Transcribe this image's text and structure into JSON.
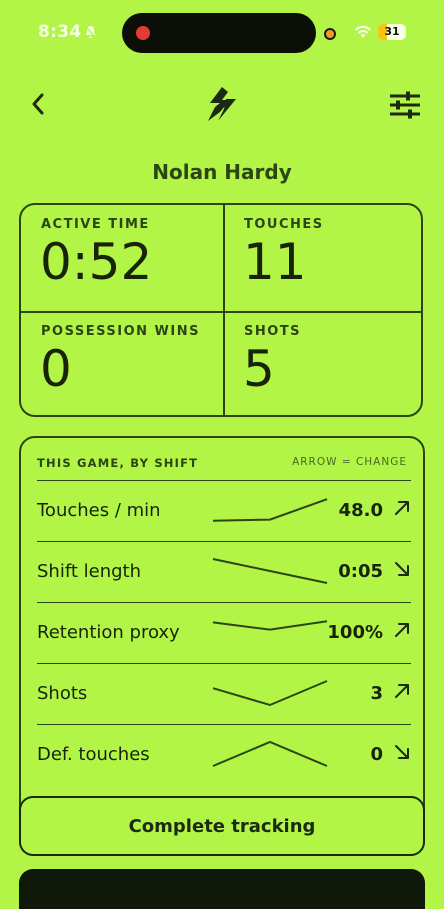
{
  "status_bar": {
    "time": "8:34",
    "battery": "31",
    "battery_level": 0.31
  },
  "player": {
    "name": "Nolan Hardy"
  },
  "stats": [
    {
      "label": "ACTIVE TIME",
      "value": "0:52"
    },
    {
      "label": "TOUCHES",
      "value": "11"
    },
    {
      "label": "POSSESSION WINS",
      "value": "0"
    },
    {
      "label": "SHOTS",
      "value": "5"
    }
  ],
  "shifts": {
    "title": "THIS GAME, BY SHIFT",
    "hint": "ARROW = CHANGE",
    "rows": [
      {
        "label": "Touches / min",
        "value": "48.0",
        "trend": "up",
        "spark": [
          0.05,
          0.1,
          0.95
        ]
      },
      {
        "label": "Shift length",
        "value": "0:05",
        "trend": "down",
        "spark": [
          1.0,
          0.5,
          0.0
        ]
      },
      {
        "label": "Retention proxy",
        "value": "100%",
        "trend": "up",
        "spark": [
          0.9,
          0.6,
          0.95
        ]
      },
      {
        "label": "Shots",
        "value": "3",
        "trend": "up",
        "spark": [
          0.7,
          0.0,
          1.0
        ]
      },
      {
        "label": "Def. touches",
        "value": "0",
        "trend": "down",
        "spark": [
          0.0,
          1.0,
          0.0
        ]
      }
    ]
  },
  "actions": {
    "complete": "Complete tracking"
  },
  "colors": {
    "background": "#b2f547",
    "ink": "#1c2a12",
    "dark_panel": "#10180a"
  }
}
